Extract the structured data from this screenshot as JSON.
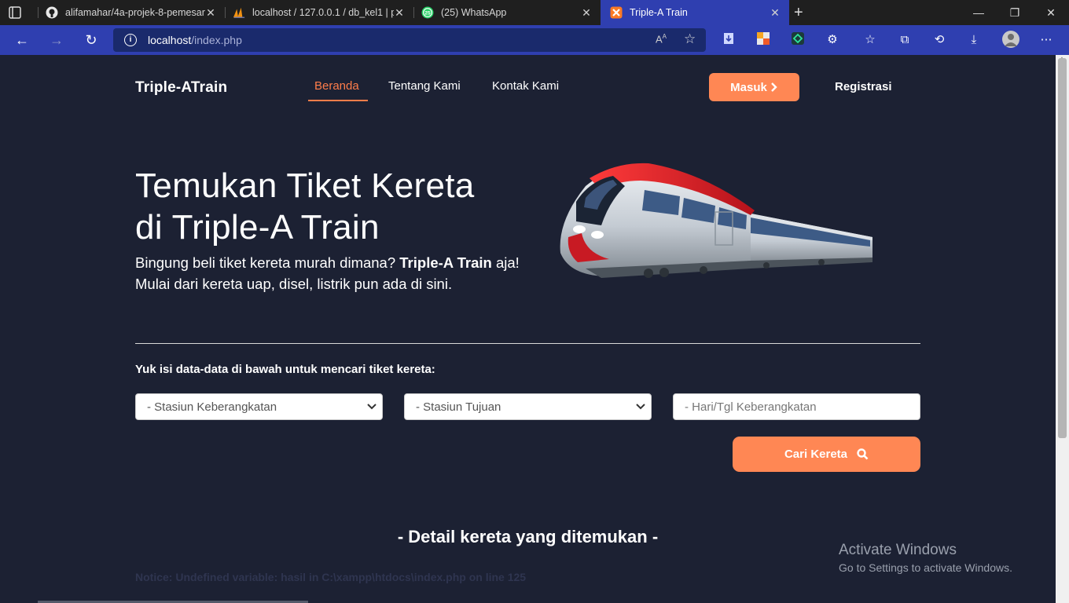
{
  "browser": {
    "tabs": [
      {
        "title": "alifamahar/4a-projek-8-pemesar",
        "icon": "github-icon"
      },
      {
        "title": "localhost / 127.0.0.1 / db_kel1 | p",
        "icon": "phpmyadmin-icon"
      },
      {
        "title": "(25) WhatsApp",
        "icon": "whatsapp-icon",
        "badge": "25"
      },
      {
        "title": "Triple-A Train",
        "icon": "xampp-icon",
        "active": true
      }
    ],
    "url_host": "localhost",
    "url_path": "/index.php"
  },
  "nav": {
    "brand": "Triple-ATrain",
    "links": [
      "Beranda",
      "Tentang Kami",
      "Kontak Kami"
    ],
    "active_link": "Beranda",
    "login_label": "Masuk",
    "register_label": "Registrasi"
  },
  "hero": {
    "title_line1": "Temukan Tiket Kereta",
    "title_line2": "di Triple-A Train",
    "subtitle_a": "Bingung beli tiket kereta murah dimana? ",
    "subtitle_bold": "Triple-A Train",
    "subtitle_b": " aja! Mulai dari kereta uap, disel, listrik pun ada di sini."
  },
  "search": {
    "prompt": "Yuk isi data-data di bawah untuk mencari tiket kereta:",
    "origin_placeholder": "- Stasiun Keberangkatan",
    "destination_placeholder": "- Stasiun Tujuan",
    "date_placeholder": "- Hari/Tgl Keberangkatan",
    "button_label": "Cari Kereta"
  },
  "results": {
    "title": "- Detail kereta yang ditemukan -",
    "notice": "Notice: Undefined variable: hasil in C:\\xampp\\htdocs\\index.php on line 125"
  },
  "watermark": {
    "line1": "Activate Windows",
    "line2": "Go to Settings to activate Windows."
  },
  "colors": {
    "accent": "#ff8754",
    "page_bg": "#1c2133",
    "browser_accent": "#2f3fb0"
  }
}
